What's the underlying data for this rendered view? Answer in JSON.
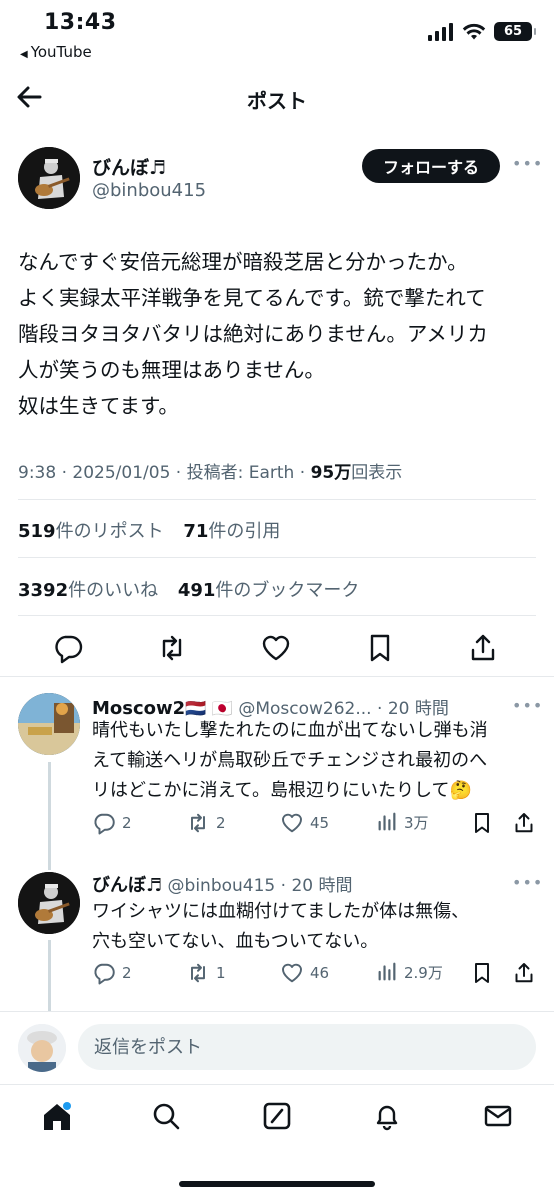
{
  "status_bar": {
    "time": "13:43",
    "back_app": "YouTube",
    "battery": "65"
  },
  "header": {
    "title": "ポスト"
  },
  "post": {
    "author_name": "びんぼ♬",
    "author_handle": "@binbou415",
    "follow_label": "フォローする",
    "text": "なんですぐ安倍元総理が暗殺芝居と分かったか。\nよく実録太平洋戦争を見てるんです。銃で撃たれて\n階段ヨタヨタバタリは絶対にありません。アメリカ\n人が笑うのも無理はありません。\n奴は生きてます。",
    "time": "9:38",
    "date": "2025/01/05",
    "poster_label": "投稿者: Earth",
    "views": "95万",
    "views_suffix": "回表示"
  },
  "stats": {
    "reposts_count": "519",
    "reposts_label": "件のリポスト",
    "quotes_count": "71",
    "quotes_label": "件の引用",
    "likes_count": "3392",
    "likes_label": "件のいいね",
    "bookmarks_count": "491",
    "bookmarks_label": "件のブックマーク"
  },
  "replies": [
    {
      "name": "Moscow2",
      "flags": "🇳🇱 🇯🇵",
      "handle": "@Moscow262...",
      "time": "20 時間",
      "text": "晴代もいたし撃たれたのに血が出てないし弾も消\nえて輸送ヘリが鳥取砂丘でチェンジされ最初のへ\nリはどこかに消えて。島根辺りにいたりして🤔",
      "replies": "2",
      "retweets": "2",
      "likes": "45",
      "views": "3万"
    },
    {
      "name": "びんぼ♬",
      "flags": "",
      "handle": "@binbou415",
      "time": "20 時間",
      "text": "ワイシャツには血糊付けてましたが体は無傷、\n穴も空いてない、血もついてない。",
      "replies": "2",
      "retweets": "1",
      "likes": "46",
      "views": "2.9万"
    }
  ],
  "composer": {
    "placeholder": "返信をポスト"
  },
  "colors": {
    "text": "#0f1419",
    "secondary": "#536471",
    "accent": "#1d9bf0",
    "divider": "#e6e9ec"
  },
  "icons": [
    "back-arrow-icon",
    "reply-icon",
    "retweet-icon",
    "heart-icon",
    "bookmark-icon",
    "share-icon",
    "views-icon",
    "home-icon",
    "search-icon",
    "grok-icon",
    "bell-icon",
    "mail-icon"
  ]
}
